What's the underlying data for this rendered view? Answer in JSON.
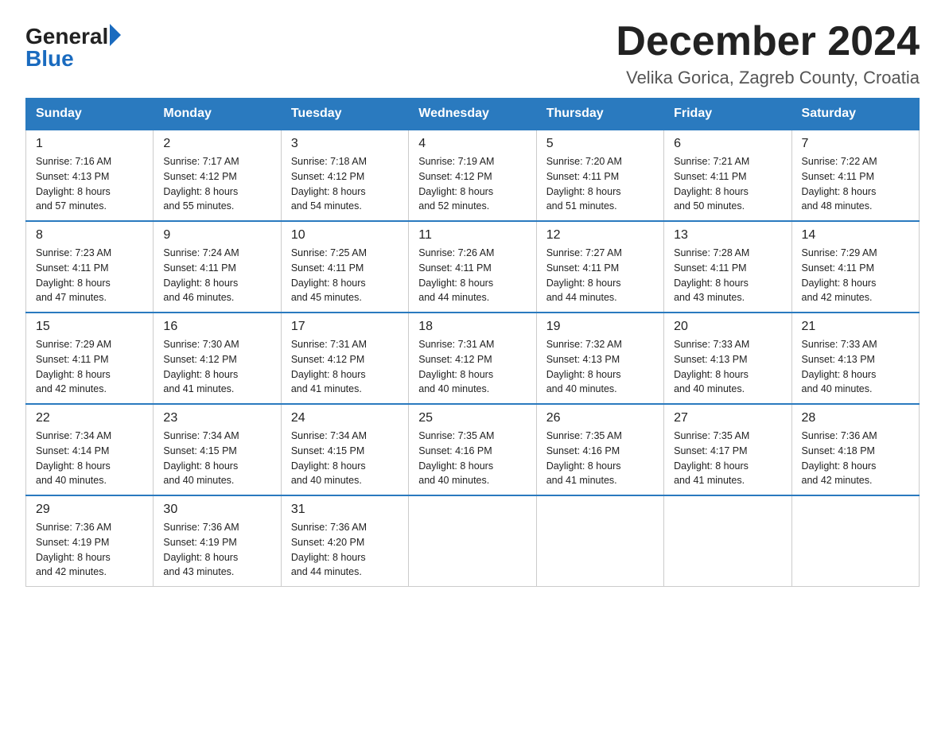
{
  "logo": {
    "general": "General",
    "blue": "Blue"
  },
  "header": {
    "month": "December 2024",
    "location": "Velika Gorica, Zagreb County, Croatia"
  },
  "days_of_week": [
    "Sunday",
    "Monday",
    "Tuesday",
    "Wednesday",
    "Thursday",
    "Friday",
    "Saturday"
  ],
  "weeks": [
    [
      {
        "day": "1",
        "sunrise": "7:16 AM",
        "sunset": "4:13 PM",
        "daylight": "8 hours and 57 minutes."
      },
      {
        "day": "2",
        "sunrise": "7:17 AM",
        "sunset": "4:12 PM",
        "daylight": "8 hours and 55 minutes."
      },
      {
        "day": "3",
        "sunrise": "7:18 AM",
        "sunset": "4:12 PM",
        "daylight": "8 hours and 54 minutes."
      },
      {
        "day": "4",
        "sunrise": "7:19 AM",
        "sunset": "4:12 PM",
        "daylight": "8 hours and 52 minutes."
      },
      {
        "day": "5",
        "sunrise": "7:20 AM",
        "sunset": "4:11 PM",
        "daylight": "8 hours and 51 minutes."
      },
      {
        "day": "6",
        "sunrise": "7:21 AM",
        "sunset": "4:11 PM",
        "daylight": "8 hours and 50 minutes."
      },
      {
        "day": "7",
        "sunrise": "7:22 AM",
        "sunset": "4:11 PM",
        "daylight": "8 hours and 48 minutes."
      }
    ],
    [
      {
        "day": "8",
        "sunrise": "7:23 AM",
        "sunset": "4:11 PM",
        "daylight": "8 hours and 47 minutes."
      },
      {
        "day": "9",
        "sunrise": "7:24 AM",
        "sunset": "4:11 PM",
        "daylight": "8 hours and 46 minutes."
      },
      {
        "day": "10",
        "sunrise": "7:25 AM",
        "sunset": "4:11 PM",
        "daylight": "8 hours and 45 minutes."
      },
      {
        "day": "11",
        "sunrise": "7:26 AM",
        "sunset": "4:11 PM",
        "daylight": "8 hours and 44 minutes."
      },
      {
        "day": "12",
        "sunrise": "7:27 AM",
        "sunset": "4:11 PM",
        "daylight": "8 hours and 44 minutes."
      },
      {
        "day": "13",
        "sunrise": "7:28 AM",
        "sunset": "4:11 PM",
        "daylight": "8 hours and 43 minutes."
      },
      {
        "day": "14",
        "sunrise": "7:29 AM",
        "sunset": "4:11 PM",
        "daylight": "8 hours and 42 minutes."
      }
    ],
    [
      {
        "day": "15",
        "sunrise": "7:29 AM",
        "sunset": "4:11 PM",
        "daylight": "8 hours and 42 minutes."
      },
      {
        "day": "16",
        "sunrise": "7:30 AM",
        "sunset": "4:12 PM",
        "daylight": "8 hours and 41 minutes."
      },
      {
        "day": "17",
        "sunrise": "7:31 AM",
        "sunset": "4:12 PM",
        "daylight": "8 hours and 41 minutes."
      },
      {
        "day": "18",
        "sunrise": "7:31 AM",
        "sunset": "4:12 PM",
        "daylight": "8 hours and 40 minutes."
      },
      {
        "day": "19",
        "sunrise": "7:32 AM",
        "sunset": "4:13 PM",
        "daylight": "8 hours and 40 minutes."
      },
      {
        "day": "20",
        "sunrise": "7:33 AM",
        "sunset": "4:13 PM",
        "daylight": "8 hours and 40 minutes."
      },
      {
        "day": "21",
        "sunrise": "7:33 AM",
        "sunset": "4:13 PM",
        "daylight": "8 hours and 40 minutes."
      }
    ],
    [
      {
        "day": "22",
        "sunrise": "7:34 AM",
        "sunset": "4:14 PM",
        "daylight": "8 hours and 40 minutes."
      },
      {
        "day": "23",
        "sunrise": "7:34 AM",
        "sunset": "4:15 PM",
        "daylight": "8 hours and 40 minutes."
      },
      {
        "day": "24",
        "sunrise": "7:34 AM",
        "sunset": "4:15 PM",
        "daylight": "8 hours and 40 minutes."
      },
      {
        "day": "25",
        "sunrise": "7:35 AM",
        "sunset": "4:16 PM",
        "daylight": "8 hours and 40 minutes."
      },
      {
        "day": "26",
        "sunrise": "7:35 AM",
        "sunset": "4:16 PM",
        "daylight": "8 hours and 41 minutes."
      },
      {
        "day": "27",
        "sunrise": "7:35 AM",
        "sunset": "4:17 PM",
        "daylight": "8 hours and 41 minutes."
      },
      {
        "day": "28",
        "sunrise": "7:36 AM",
        "sunset": "4:18 PM",
        "daylight": "8 hours and 42 minutes."
      }
    ],
    [
      {
        "day": "29",
        "sunrise": "7:36 AM",
        "sunset": "4:19 PM",
        "daylight": "8 hours and 42 minutes."
      },
      {
        "day": "30",
        "sunrise": "7:36 AM",
        "sunset": "4:19 PM",
        "daylight": "8 hours and 43 minutes."
      },
      {
        "day": "31",
        "sunrise": "7:36 AM",
        "sunset": "4:20 PM",
        "daylight": "8 hours and 44 minutes."
      },
      null,
      null,
      null,
      null
    ]
  ],
  "labels": {
    "sunrise": "Sunrise:",
    "sunset": "Sunset:",
    "daylight": "Daylight:"
  }
}
